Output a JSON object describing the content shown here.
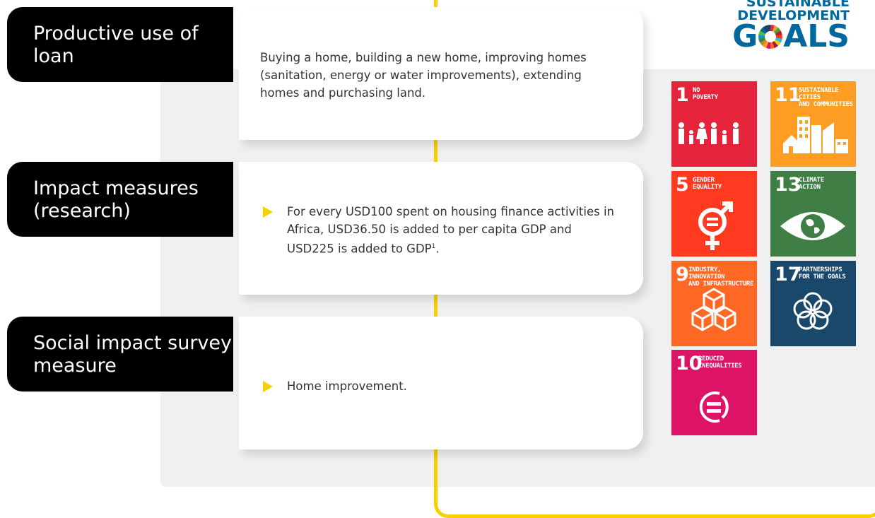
{
  "rows": [
    {
      "label": "Productive use of loan",
      "text": "Buying a home, building a new home, improving homes (sanitation, energy or water improvements), extending homes and purchasing land."
    },
    {
      "label": "Impact measures (research)",
      "bullet": "For every USD100 spent on housing finance activities in Africa, USD36.50 is added to per capita GDP and USD225 is added to GDP",
      "footnote": "1",
      "end": "."
    },
    {
      "label": "Social impact survey measure",
      "bullet": "Home improvement."
    }
  ],
  "sdg_logo": {
    "line1": "SUSTAINABLE",
    "line2": "DEVELOPMENT",
    "goals_g": "G",
    "goals_rest": "ALS"
  },
  "goals": [
    {
      "num": "1",
      "title": "NO\nPOVERTY",
      "color": "#e5243b",
      "icon": "family-icon"
    },
    {
      "num": "11",
      "title": "SUSTAINABLE CITIES\nAND COMMUNITIES",
      "color": "#fd9d24",
      "icon": "city-icon"
    },
    {
      "num": "5",
      "title": "GENDER\nEQUALITY",
      "color": "#ff3a21",
      "icon": "gender-equality-icon"
    },
    {
      "num": "13",
      "title": "CLIMATE\nACTION",
      "color": "#3f7e44",
      "icon": "eye-globe-icon"
    },
    {
      "num": "9",
      "title": "INDUSTRY, INNOVATION\nAND INFRASTRUCTURE",
      "color": "#fd6925",
      "icon": "cubes-icon"
    },
    {
      "num": "17",
      "title": "PARTNERSHIPS\nFOR THE GOALS",
      "color": "#19486a",
      "icon": "rings-icon"
    },
    {
      "num": "10",
      "title": "REDUCED\nINEQUALITIES",
      "color": "#dd1367",
      "icon": "equals-circle-icon"
    }
  ]
}
